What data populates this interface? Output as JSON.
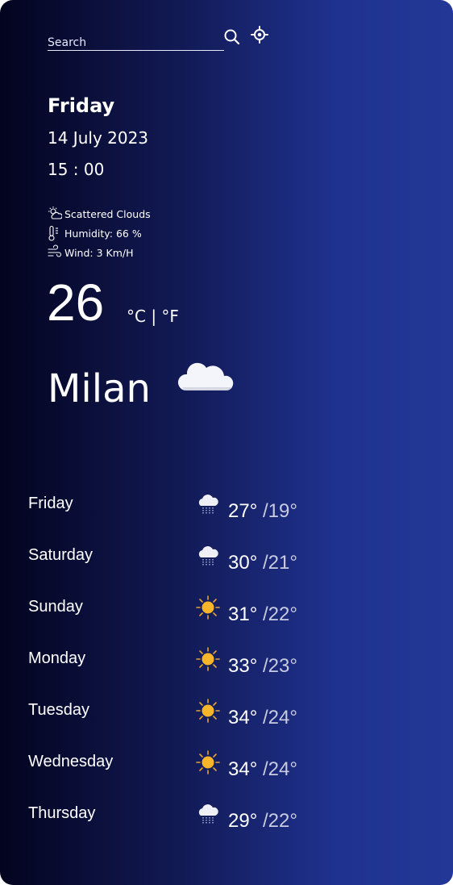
{
  "search": {
    "placeholder": "Search"
  },
  "current": {
    "day": "Friday",
    "date": "14 July 2023",
    "time": "15 : 00",
    "condition": "Scattered Clouds",
    "humidity": "Humidity: 66 %",
    "wind": "Wind: 3 Km/H",
    "temperature": "26",
    "units": "°C | °F",
    "city": "Milan",
    "icon": "cloud-icon"
  },
  "forecast": [
    {
      "day": "Friday",
      "high": "27°",
      "low": "/19°",
      "icon": "rain-cloud-icon"
    },
    {
      "day": "Saturday",
      "high": "30°",
      "low": "/21°",
      "icon": "rain-cloud-icon"
    },
    {
      "day": "Sunday",
      "high": "31°",
      "low": "/22°",
      "icon": "sun-icon"
    },
    {
      "day": "Monday",
      "high": "33°",
      "low": "/23°",
      "icon": "sun-icon"
    },
    {
      "day": "Tuesday",
      "high": "34°",
      "low": "/24°",
      "icon": "sun-icon"
    },
    {
      "day": "Wednesday",
      "high": "34°",
      "low": "/24°",
      "icon": "sun-icon"
    },
    {
      "day": "Thursday",
      "high": "29°",
      "low": "/22°",
      "icon": "rain-cloud-icon"
    }
  ],
  "colors": {
    "gradient_start": "#03041f",
    "gradient_end": "#233896",
    "sun": "#f9b52a",
    "low_temp": "#c8cbe0"
  }
}
